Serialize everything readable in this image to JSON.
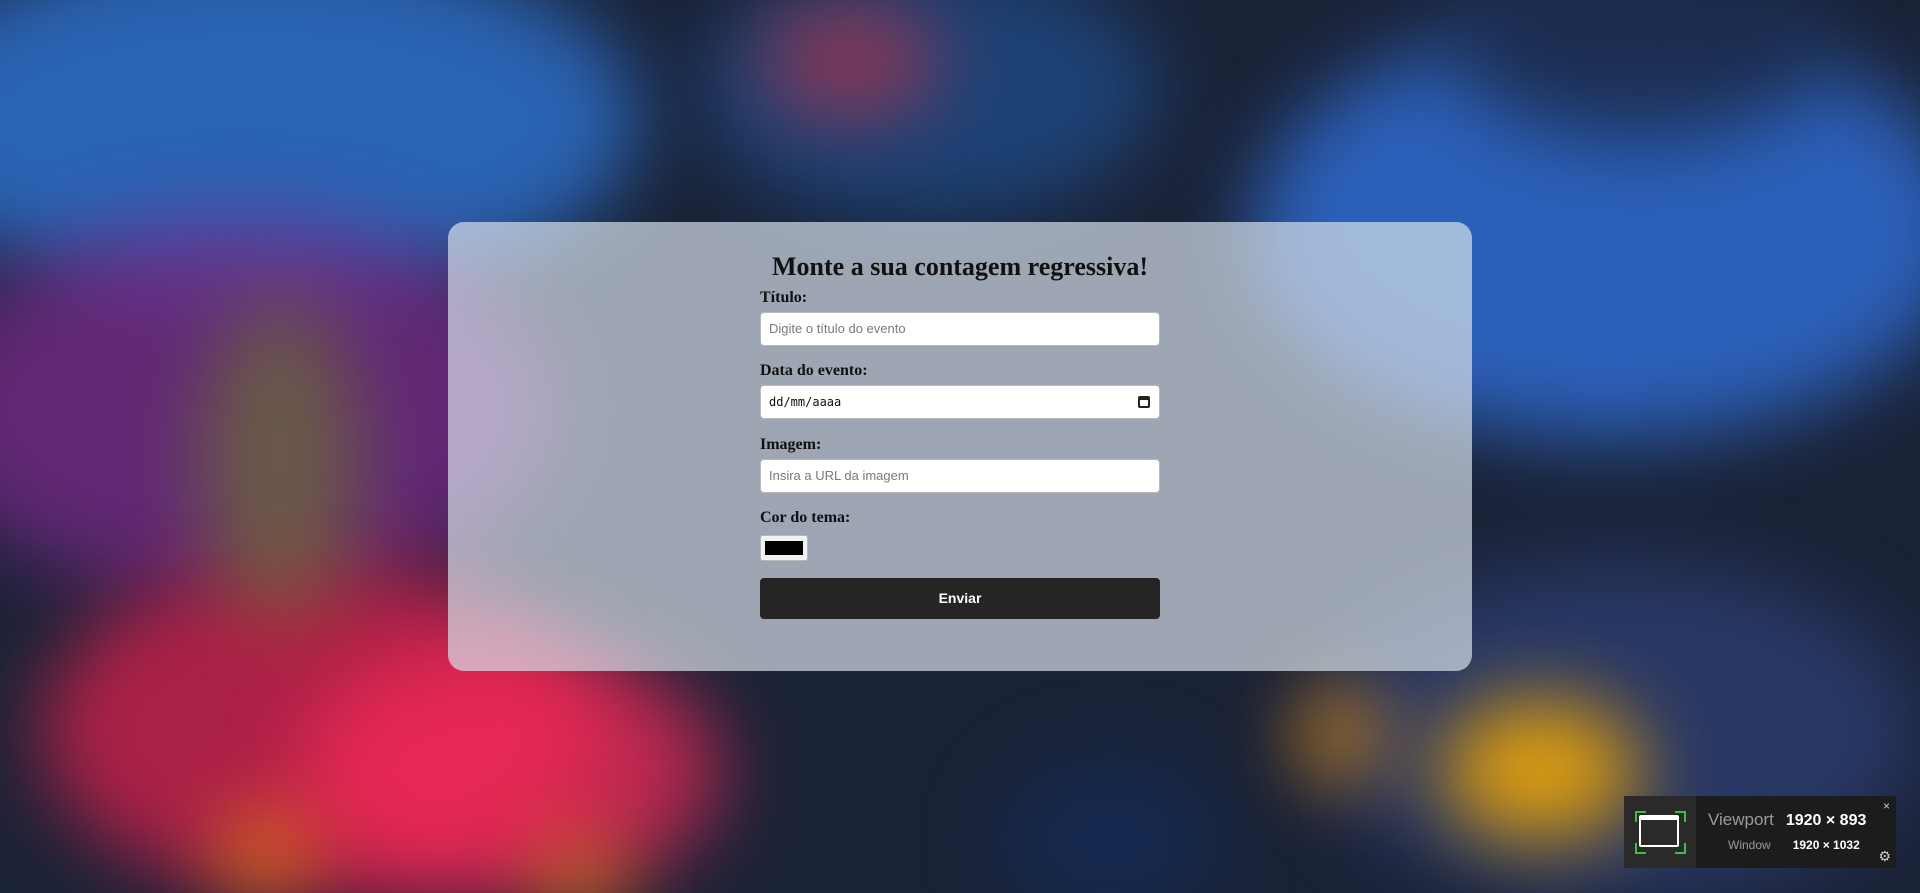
{
  "form": {
    "heading": "Monte a sua contagem regressiva!",
    "title_label": "Título:",
    "title_placeholder": "Digite o título do evento",
    "date_label": "Data do evento:",
    "date_value": "dd/mm/aaaa",
    "image_label": "Imagem:",
    "image_placeholder": "Insira a URL da imagem",
    "color_label": "Cor do tema:",
    "color_value": "#000000",
    "submit_label": "Enviar"
  },
  "viewport_widget": {
    "viewport_label": "Viewport",
    "viewport_size": "1920 × 893",
    "window_label": "Window",
    "window_size": "1920 × 1032",
    "close_icon": "×",
    "gear_icon": "⚙"
  },
  "colors": {
    "card_bg": "rgba(220,228,238,0.68)",
    "button_bg": "#262425",
    "accent_green": "#3fbf3f"
  },
  "icons": [
    "calendar-icon",
    "close-icon",
    "gear-icon",
    "viewport-frame-icon"
  ]
}
